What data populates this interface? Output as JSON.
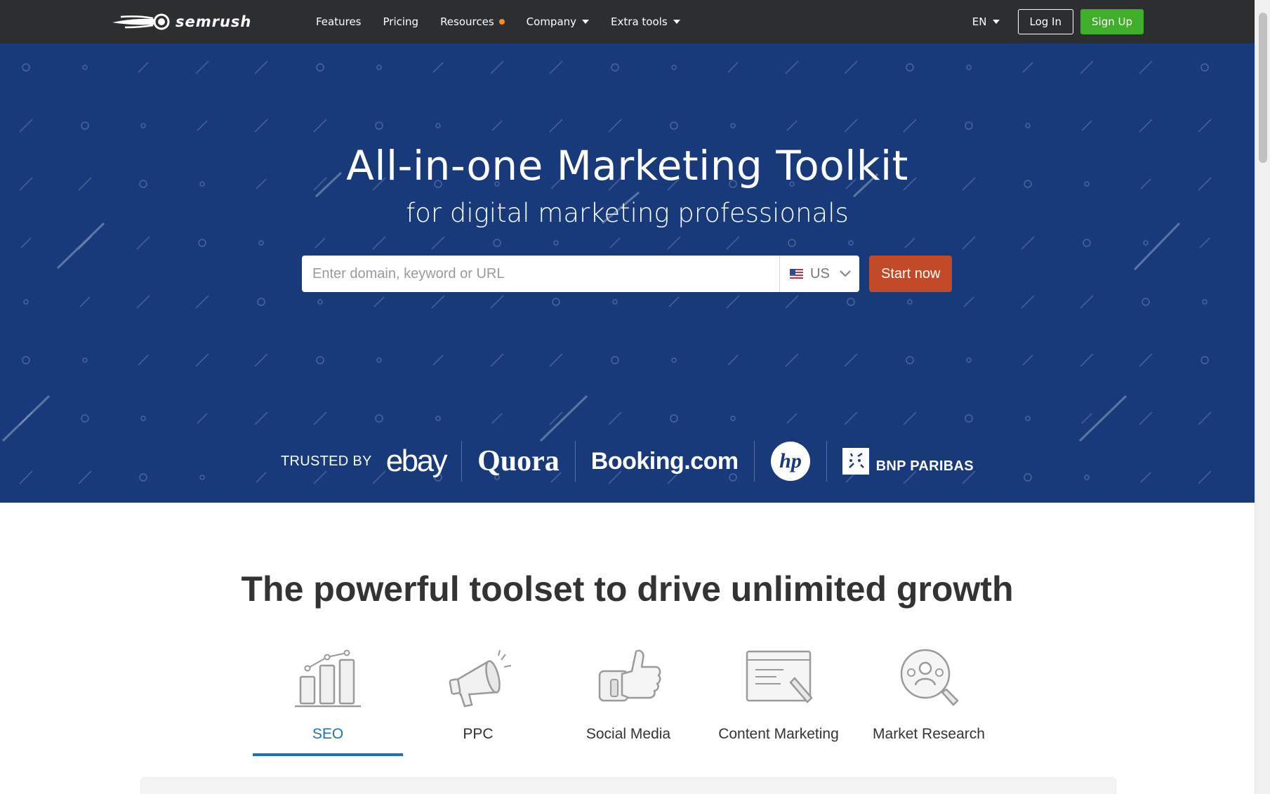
{
  "brand": {
    "name": "semrush"
  },
  "nav": {
    "links": [
      {
        "label": "Features",
        "caret": false,
        "dot": false
      },
      {
        "label": "Pricing",
        "caret": false,
        "dot": false
      },
      {
        "label": "Resources",
        "caret": false,
        "dot": true
      },
      {
        "label": "Company",
        "caret": true,
        "dot": false
      },
      {
        "label": "Extra tools",
        "caret": true,
        "dot": false
      }
    ],
    "language": "EN",
    "login_label": "Log In",
    "signup_label": "Sign Up"
  },
  "hero": {
    "title": "All-in-one Marketing Toolkit",
    "subtitle": "for digital marketing professionals",
    "search_placeholder": "Enter domain, keyword or URL",
    "search_value": "",
    "country": "US",
    "start_label": "Start now",
    "trusted_label": "TRUSTED BY",
    "trusted_brands": [
      "ebay",
      "Quora",
      "Booking.com",
      "hp",
      "BNP PARIBAS"
    ]
  },
  "tools": {
    "title": "The powerful toolset to drive unlimited growth",
    "tabs": [
      {
        "label": "SEO",
        "icon": "bar-chart-icon",
        "active": true
      },
      {
        "label": "PPC",
        "icon": "megaphone-icon",
        "active": false
      },
      {
        "label": "Social Media",
        "icon": "thumbs-up-icon",
        "active": false
      },
      {
        "label": "Content Marketing",
        "icon": "document-pencil-icon",
        "active": false
      },
      {
        "label": "Market Research",
        "icon": "magnifier-people-icon",
        "active": false
      }
    ]
  },
  "colors": {
    "nav_bg": "#2d2e30",
    "hero_bg": "#183a7b",
    "signup": "#3fae2a",
    "start": "#c24a28",
    "resources_dot": "#ff8c1a",
    "active_tab": "#1f72b8"
  }
}
